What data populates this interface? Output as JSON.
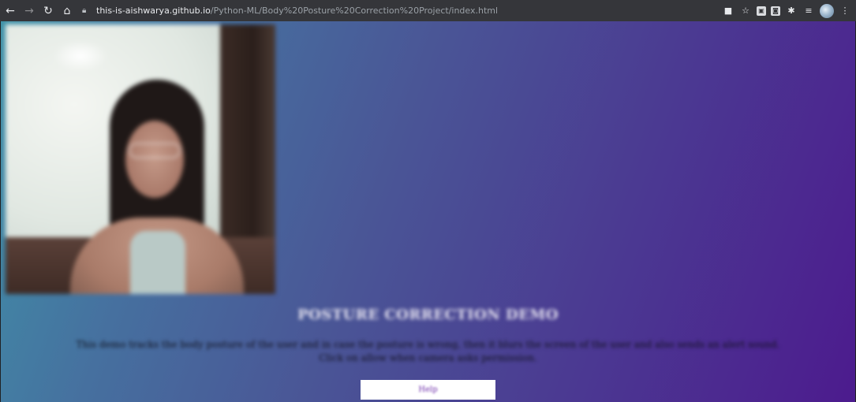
{
  "browser": {
    "url_host": "this-is-aishwarya.github.io",
    "url_path": "/Python-ML/Body%20Posture%20Correction%20Project/index.html",
    "icons": [
      "back-arrow-icon",
      "forward-arrow-icon",
      "reload-icon",
      "home-icon",
      "lock-icon",
      "camera-in-use-icon",
      "star-icon",
      "extension-icon",
      "extension-icon",
      "puzzle-icon",
      "reading-list-icon",
      "profile-avatar-icon",
      "menu-dots-icon"
    ]
  },
  "page": {
    "heading": "POSTURE CORRECTION DEMO",
    "description_line1": "This demo tracks the body posture of the user and in case the posture is wrong, then it blurs the screen of the user and also sends an alert sound.",
    "description_line2": "Click on allow when camera asks permission.",
    "help_button": "Help",
    "colors": {
      "gradient_start": "#3f92a8",
      "gradient_end": "#4c1b8e",
      "button_text": "#6b2aa8"
    }
  }
}
